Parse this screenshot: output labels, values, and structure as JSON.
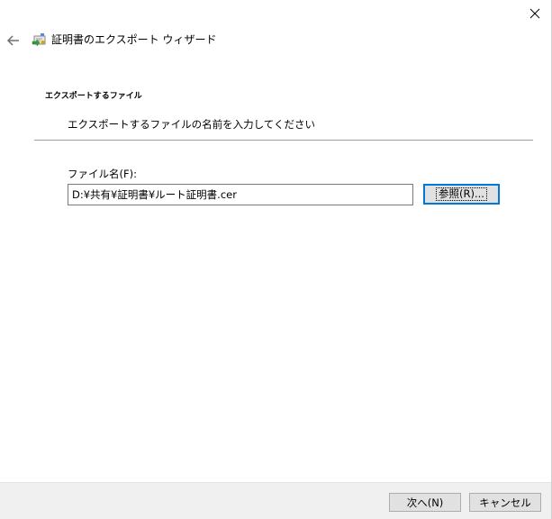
{
  "window": {
    "close_icon": "close-icon",
    "back_icon": "back-arrow-icon"
  },
  "wizard": {
    "title": "証明書のエクスポート ウィザード",
    "icon": "certificate-wizard-icon"
  },
  "page": {
    "heading": "エクスポートするファイル",
    "subheading": "エクスポートするファイルの名前を入力してください"
  },
  "form": {
    "file_label": "ファイル名(F):",
    "file_value": "D:¥共有¥証明書¥ルート証明書.cer",
    "browse_label": "参照(R)..."
  },
  "footer": {
    "next_label": "次へ(N)",
    "cancel_label": "キャンセル"
  },
  "colors": {
    "focus_border": "#0078d7",
    "button_face": "#e1e1e1",
    "footer_bg": "#f0f0f0"
  }
}
